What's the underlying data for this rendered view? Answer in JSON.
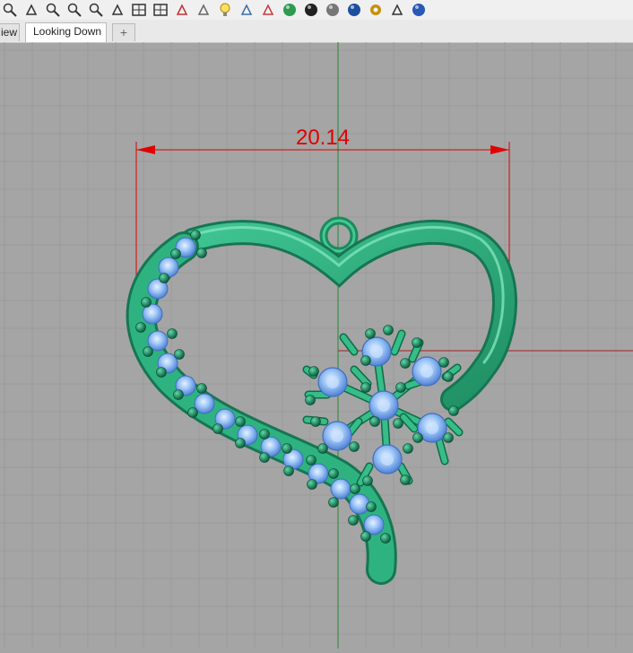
{
  "toolbar": {
    "icons": [
      "zoom-dynamic-icon",
      "pan-icon",
      "zoom-window-icon",
      "zoom-extents-icon",
      "zoom-selected-icon",
      "rotate-view-icon",
      "four-viewports-icon",
      "named-views-icon",
      "render-icon",
      "shade-icon",
      "light-bulb-icon",
      "properties-icon",
      "layers-icon",
      "color-wheel-icon",
      "material-sphere-dark-icon",
      "material-sphere-gray-icon",
      "material-sphere-blue-icon",
      "options-gear-icon",
      "snap-icon",
      "help-icon"
    ]
  },
  "tabs": {
    "partial_label": "iew",
    "active_label": "Looking Down",
    "add_label": "+"
  },
  "viewport": {
    "dimension_value": "20.14",
    "grid_color": "#9a9a9a",
    "background": "#a5a5a5",
    "dimension_color": "#e00000",
    "model_color": "#2aa77a",
    "gem_color": "#8fbdf5"
  }
}
